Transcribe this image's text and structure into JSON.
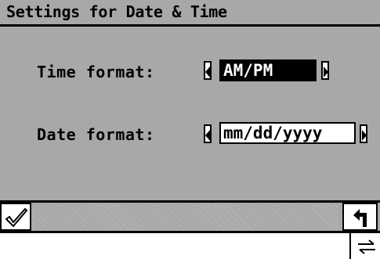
{
  "window": {
    "title": "Settings for Date & Time"
  },
  "settings": [
    {
      "label": "Time format:",
      "value": "AM/PM",
      "selected": true
    },
    {
      "label": "Date format:",
      "value": "mm/dd/yyyy",
      "selected": false
    }
  ],
  "toolbar": {
    "confirm_icon": "checkmark-icon",
    "back_icon": "return-arrow-icon"
  },
  "status": {
    "icon": "switch-arrows-icon"
  },
  "colors": {
    "panel": "#a8a8a8",
    "text": "#000000",
    "highlight": "#000000",
    "background": "#ffffff"
  }
}
